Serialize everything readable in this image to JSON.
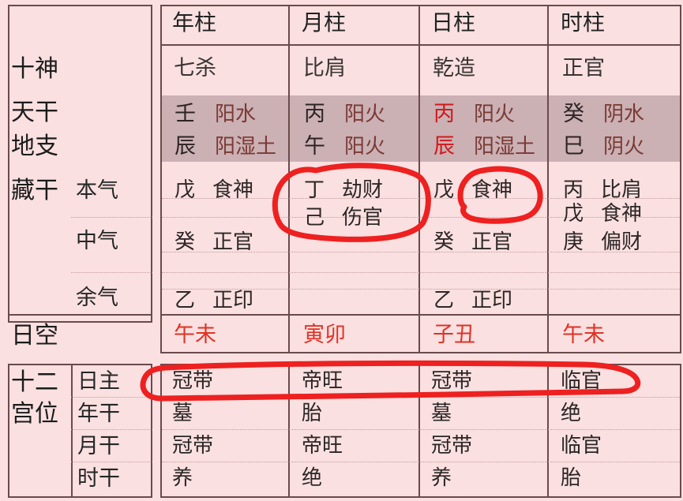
{
  "chart": {
    "title_row": {
      "label": "",
      "pillars": [
        "年柱",
        "月柱",
        "日柱",
        "时柱"
      ]
    },
    "row_labels": {
      "ten_gods": "十神",
      "heaven_stem": "天干",
      "earth_branch": "地支",
      "hidden_stems": "藏干",
      "day_void": "日空",
      "twelve_palaces": "十二宫位"
    },
    "hidden_stem_sublabels": [
      "本气",
      "中气",
      "余气"
    ],
    "palace_sublabels": [
      "日主",
      "年干",
      "月干",
      "时干"
    ],
    "ten_gods": [
      "七杀",
      "比肩",
      "乾造",
      "正官"
    ],
    "heaven_stems": [
      {
        "stem": "壬",
        "element": "阳水",
        "highlight": false
      },
      {
        "stem": "丙",
        "element": "阳火",
        "highlight": false
      },
      {
        "stem": "丙",
        "element": "阳火",
        "highlight": true
      },
      {
        "stem": "癸",
        "element": "阴水",
        "highlight": false
      }
    ],
    "earth_branches": [
      {
        "branch": "辰",
        "element": "阳湿土",
        "highlight": false
      },
      {
        "branch": "午",
        "element": "阳火",
        "highlight": false
      },
      {
        "branch": "辰",
        "element": "阳湿土",
        "highlight": true
      },
      {
        "branch": "巳",
        "element": "阴火",
        "highlight": false
      }
    ],
    "hidden_stems": {
      "year": [
        {
          "stem": "戊",
          "god": "食神"
        },
        {
          "stem": "癸",
          "god": "正官"
        },
        {
          "stem": "乙",
          "god": "正印"
        }
      ],
      "month": [
        {
          "stem": "丁",
          "god": "劫财"
        },
        {
          "stem": "己",
          "god": "伤官"
        }
      ],
      "day": [
        {
          "stem": "戊",
          "god": "食神"
        },
        {
          "stem": "癸",
          "god": "正官"
        },
        {
          "stem": "乙",
          "god": "正印"
        }
      ],
      "hour": [
        {
          "stem": "丙",
          "god": "比肩"
        },
        {
          "stem": "戊",
          "god": "食神"
        },
        {
          "stem": "庚",
          "god": "偏财"
        }
      ]
    },
    "day_void": [
      "午未",
      "寅卯",
      "子丑",
      "午未"
    ],
    "twelve_palaces": [
      {
        "label": "日主",
        "values": [
          "冠带",
          "帝旺",
          "冠带",
          "临官"
        ]
      },
      {
        "label": "年干",
        "values": [
          "墓",
          "胎",
          "墓",
          "绝"
        ]
      },
      {
        "label": "月干",
        "values": [
          "冠带",
          "帝旺",
          "冠带",
          "临官"
        ]
      },
      {
        "label": "时干",
        "values": [
          "养",
          "绝",
          "养",
          "胎"
        ]
      }
    ],
    "annotations": [
      {
        "name": "circle-month-hidden-stems",
        "shape": "ellipse-handdrawn",
        "color": "#ef2020"
      },
      {
        "name": "circle-day-shishen",
        "shape": "ellipse-handdrawn",
        "color": "#ef2020"
      },
      {
        "name": "underline-day-master-row",
        "shape": "long-loop",
        "color": "#ee2020"
      }
    ],
    "colors": {
      "background": "#fae0e0",
      "cell_background": "#fbe2e2",
      "border": "#6b4a4d",
      "highlight_band": "#cbb0b4",
      "accent_red": "#d1191b",
      "void_red": "#e03225",
      "annotation_red": "#ef2020"
    }
  }
}
